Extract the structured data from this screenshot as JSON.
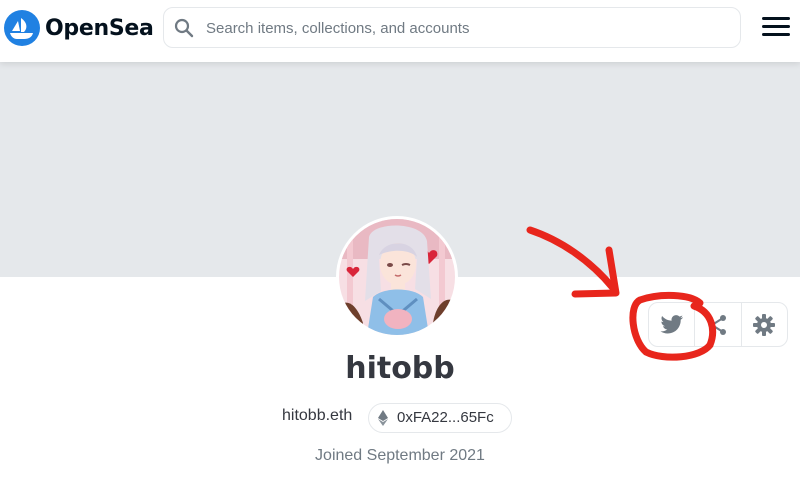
{
  "header": {
    "brand": "OpenSea",
    "logo_icon": "boat-logo-icon",
    "search": {
      "placeholder": "Search items, collections, and accounts",
      "value": ""
    },
    "menu_icon": "hamburger-menu-icon"
  },
  "profile": {
    "username": "hitobb",
    "ens_name": "hitobb.eth",
    "address_short": "0xFA22...65Fc",
    "joined": "Joined September 2021"
  },
  "actions": {
    "twitter_icon": "twitter-icon",
    "share_icon": "share-icon",
    "settings_icon": "gear-icon"
  },
  "colors": {
    "brand_blue": "#2081e2",
    "banner": "#e5e8eb",
    "annotation_red": "#e8261c"
  }
}
